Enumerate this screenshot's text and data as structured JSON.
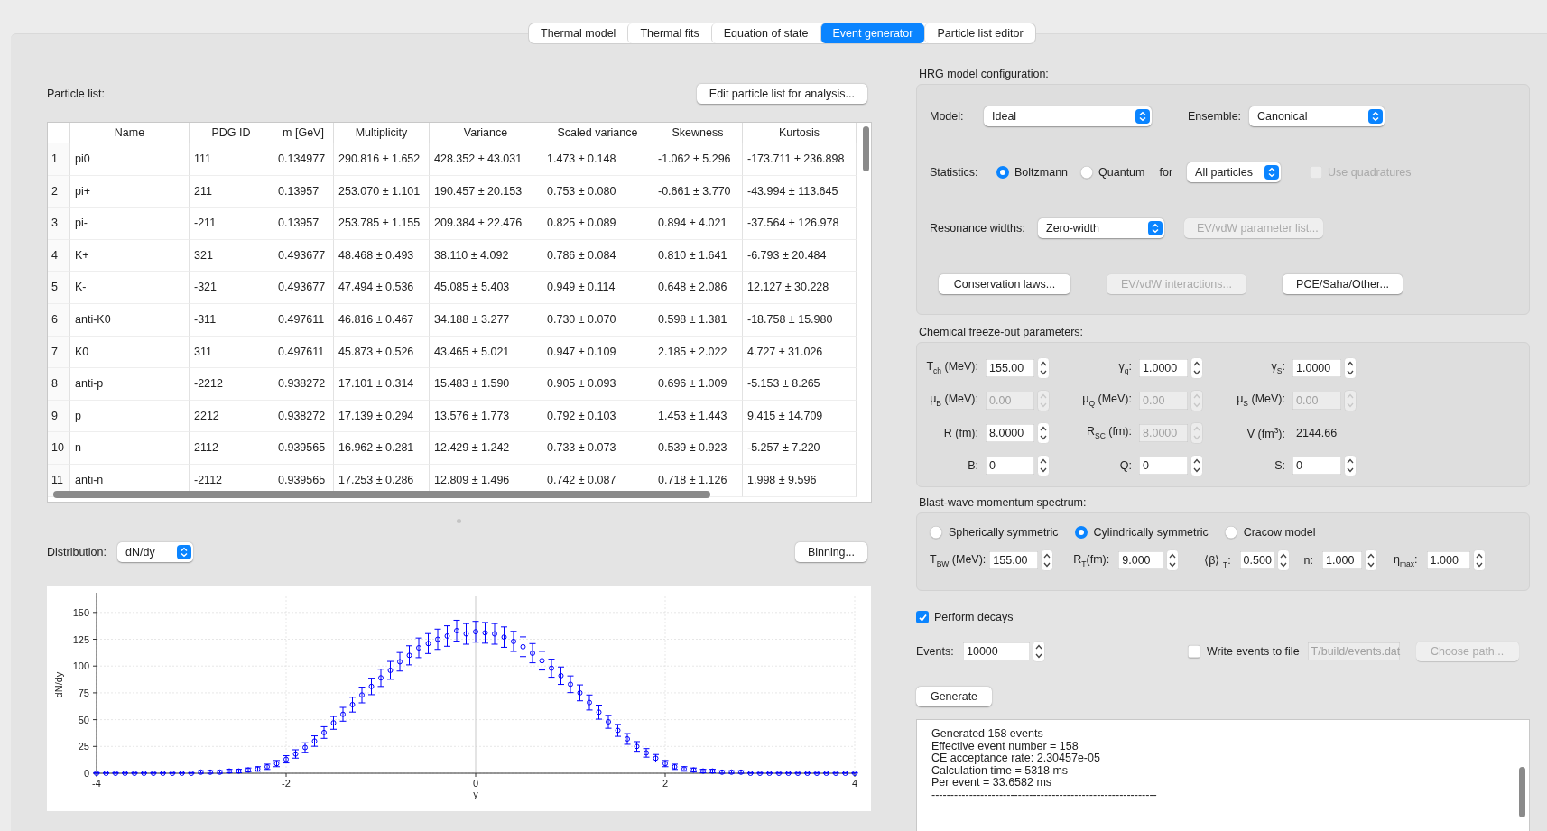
{
  "tabs": [
    {
      "label": "Thermal model",
      "selected": false
    },
    {
      "label": "Thermal fits",
      "selected": false
    },
    {
      "label": "Equation of state",
      "selected": false
    },
    {
      "label": "Event generator",
      "selected": true
    },
    {
      "label": "Particle list editor",
      "selected": false
    }
  ],
  "particle_list": {
    "label": "Particle list:",
    "edit_button": "Edit particle list for analysis...",
    "columns": [
      "Name",
      "PDG ID",
      "m [GeV]",
      "Multiplicity",
      "Variance",
      "Scaled variance",
      "Skewness",
      "Kurtosis"
    ],
    "rows": [
      {
        "index": "1",
        "cells": [
          "pi0",
          "111",
          "0.134977",
          "290.816 ± 1.652",
          "428.352 ± 43.031",
          "1.473 ± 0.148",
          "-1.062 ± 5.296",
          "-173.711 ± 236.898"
        ]
      },
      {
        "index": "2",
        "cells": [
          "pi+",
          "211",
          "0.13957",
          "253.070 ± 1.101",
          "190.457 ± 20.153",
          "0.753 ± 0.080",
          "-0.661 ± 3.770",
          "-43.994 ± 113.645"
        ]
      },
      {
        "index": "3",
        "cells": [
          "pi-",
          "-211",
          "0.13957",
          "253.785 ± 1.155",
          "209.384 ± 22.476",
          "0.825 ± 0.089",
          "0.894 ± 4.021",
          "-37.564 ± 126.978"
        ]
      },
      {
        "index": "4",
        "cells": [
          "K+",
          "321",
          "0.493677",
          "48.468 ± 0.493",
          "38.110 ± 4.092",
          "0.786 ± 0.084",
          "0.810 ± 1.641",
          "-6.793 ± 20.484"
        ]
      },
      {
        "index": "5",
        "cells": [
          "K-",
          "-321",
          "0.493677",
          "47.494 ± 0.536",
          "45.085 ± 5.403",
          "0.949 ± 0.114",
          "0.648 ± 2.086",
          "12.127 ± 30.228"
        ]
      },
      {
        "index": "6",
        "cells": [
          "anti-K0",
          "-311",
          "0.497611",
          "46.816 ± 0.467",
          "34.188 ± 3.277",
          "0.730 ± 0.070",
          "0.598 ± 1.381",
          "-18.758 ± 15.980"
        ]
      },
      {
        "index": "7",
        "cells": [
          "K0",
          "311",
          "0.497611",
          "45.873 ± 0.526",
          "43.465 ± 5.021",
          "0.947 ± 0.109",
          "2.185 ± 2.022",
          "4.727 ± 31.026"
        ]
      },
      {
        "index": "8",
        "cells": [
          "anti-p",
          "-2212",
          "0.938272",
          "17.101 ± 0.314",
          "15.483 ± 1.590",
          "0.905 ± 0.093",
          "0.696 ± 1.009",
          "-5.153 ± 8.265"
        ]
      },
      {
        "index": "9",
        "cells": [
          "p",
          "2212",
          "0.938272",
          "17.139 ± 0.294",
          "13.576 ± 1.773",
          "0.792 ± 0.103",
          "1.453 ± 1.443",
          "9.415 ± 14.709"
        ]
      },
      {
        "index": "10",
        "cells": [
          "n",
          "2112",
          "0.939565",
          "16.962 ± 0.281",
          "12.429 ± 1.242",
          "0.733 ± 0.073",
          "0.539 ± 0.923",
          "-5.257 ± 7.220"
        ]
      },
      {
        "index": "11",
        "cells": [
          "anti-n",
          "-2112",
          "0.939565",
          "17.253 ± 0.286",
          "12.809 ± 1.496",
          "0.742 ± 0.087",
          "0.718 ± 1.126",
          "1.998 ± 9.596"
        ]
      }
    ]
  },
  "distribution": {
    "label": "Distribution:",
    "value": "dN/dy",
    "binning_button": "Binning...",
    "chart_data": {
      "type": "scatter",
      "xlabel": "y",
      "ylabel": "dN/dy",
      "xlim": [
        -4,
        4
      ],
      "ylim": [
        0,
        165
      ],
      "xticks": [
        -4,
        -2,
        0,
        2,
        4
      ],
      "yticks": [
        0,
        25,
        50,
        75,
        100,
        125,
        150
      ],
      "x": [
        -4,
        -3.9,
        -3.8,
        -3.7,
        -3.6,
        -3.5,
        -3.4,
        -3.3,
        -3.2,
        -3.1,
        -3,
        -2.9,
        -2.8,
        -2.7,
        -2.6,
        -2.5,
        -2.4,
        -2.3,
        -2.2,
        -2.1,
        -2,
        -1.9,
        -1.8,
        -1.7,
        -1.6,
        -1.5,
        -1.4,
        -1.3,
        -1.2,
        -1.1,
        -1,
        -0.9,
        -0.8,
        -0.7,
        -0.6,
        -0.5,
        -0.4,
        -0.3,
        -0.2,
        -0.1,
        0,
        0.1,
        0.2,
        0.3,
        0.4,
        0.5,
        0.6,
        0.7,
        0.8,
        0.9,
        1,
        1.1,
        1.2,
        1.3,
        1.4,
        1.5,
        1.6,
        1.7,
        1.8,
        1.9,
        2,
        2.1,
        2.2,
        2.3,
        2.4,
        2.5,
        2.6,
        2.7,
        2.8,
        2.9,
        3,
        3.1,
        3.2,
        3.3,
        3.4,
        3.5,
        3.6,
        3.7,
        3.8,
        3.9,
        4
      ],
      "grid": true,
      "series": [
        {
          "color": "#0000ff",
          "values": [
            0,
            0,
            0,
            0,
            0,
            0,
            0,
            0,
            0,
            0,
            0,
            1,
            1,
            1,
            2,
            2,
            3,
            4,
            6,
            9,
            13,
            18,
            24,
            30,
            38,
            47,
            55,
            64,
            73,
            81,
            89,
            96,
            104,
            110,
            117,
            121,
            125,
            128,
            133,
            130,
            132,
            131,
            130,
            127,
            123,
            118,
            112,
            105,
            98,
            91,
            83,
            75,
            66,
            57,
            48,
            40,
            32,
            25,
            19,
            14,
            9,
            6,
            4,
            3,
            2,
            2,
            1,
            1,
            1,
            0,
            0,
            0,
            0,
            0,
            0,
            0,
            0,
            0,
            0,
            0,
            0
          ]
        }
      ]
    }
  },
  "hrg": {
    "title": "HRG model configuration:",
    "model": {
      "label": "Model:",
      "value": "Ideal"
    },
    "ensemble": {
      "label": "Ensemble:",
      "value": "Canonical"
    },
    "statistics": {
      "label": "Statistics:",
      "options": [
        {
          "label": "Boltzmann",
          "selected": true
        },
        {
          "label": "Quantum",
          "selected": false
        }
      ],
      "for_label": "for",
      "for_value": "All particles",
      "quadratures": {
        "label": "Use quadratures",
        "checked": false,
        "disabled": true
      }
    },
    "resonance": {
      "label": "Resonance widths:",
      "value": "Zero-width",
      "param_button": {
        "label": "EV/vdW parameter list...",
        "disabled": true
      }
    },
    "buttons": [
      {
        "label": "Conservation laws...",
        "disabled": false
      },
      {
        "label": "EV/vdW interactions...",
        "disabled": true
      },
      {
        "label": "PCE/Saha/Other...",
        "disabled": false
      }
    ]
  },
  "chemical": {
    "title": "Chemical freeze-out parameters:",
    "rows": [
      [
        {
          "kind": "spin",
          "label": "T$_{ch}$ (MeV):",
          "value": "155.00",
          "disabled": false
        },
        {
          "kind": "spin",
          "label": "γ$_{q}$:",
          "value": "1.0000",
          "disabled": false
        },
        {
          "kind": "spin",
          "label": "γ$_{S}$:",
          "value": "1.0000",
          "disabled": false
        }
      ],
      [
        {
          "kind": "spin",
          "label": "μ$_{B}$ (MeV):",
          "value": "0.00",
          "disabled": true
        },
        {
          "kind": "spin",
          "label": "μ$_{Q}$ (MeV):",
          "value": "0.00",
          "disabled": true
        },
        {
          "kind": "spin",
          "label": "μ$_{S}$ (MeV):",
          "value": "0.00",
          "disabled": true
        }
      ],
      [
        {
          "kind": "spin",
          "label": "R (fm):",
          "value": "8.0000",
          "disabled": false
        },
        {
          "kind": "spin",
          "label": "R$_{SC}$ (fm):",
          "value": "8.0000",
          "disabled": true
        },
        {
          "kind": "readout",
          "label": "V (fm$^{3}$):",
          "value": "2144.66"
        }
      ],
      [
        {
          "kind": "spin",
          "label": "B:",
          "value": "0",
          "disabled": false
        },
        {
          "kind": "spin",
          "label": "Q:",
          "value": "0",
          "disabled": false
        },
        {
          "kind": "spin",
          "label": "S:",
          "value": "0",
          "disabled": false
        }
      ]
    ]
  },
  "blast_wave": {
    "title": "Blast-wave momentum spectrum:",
    "models": [
      {
        "label": "Spherically symmetric",
        "selected": false
      },
      {
        "label": "Cylindrically symmetric",
        "selected": true
      },
      {
        "label": "Cracow model",
        "selected": false
      }
    ],
    "params": [
      {
        "label": "T$_{BW}$ (MeV):",
        "value": "155.00"
      },
      {
        "label": "R$_{T}$(fm):",
        "value": "9.000"
      },
      {
        "label": "⟨β⟩ $_{T}$:",
        "value": "0.500"
      },
      {
        "label": "n:",
        "value": "1.000"
      },
      {
        "label": "η$_{max}$:",
        "value": "1.000"
      }
    ]
  },
  "perform_decays": {
    "label": "Perform decays",
    "checked": true
  },
  "events": {
    "label": "Events:",
    "value": "10000"
  },
  "write_file": {
    "label": "Write events to file",
    "checked": false,
    "path": "T/build/events.dat",
    "path_disabled": true,
    "choose_button": {
      "label": "Choose path...",
      "disabled": true
    }
  },
  "generate_button": "Generate",
  "log": [
    "Generated 158 events",
    "Effective event number = 158",
    "CE acceptance rate: 2.30457e-05",
    "Calculation time = 5318 ms",
    "Per event = 33.6582 ms",
    "------------------------------------------------------------"
  ]
}
